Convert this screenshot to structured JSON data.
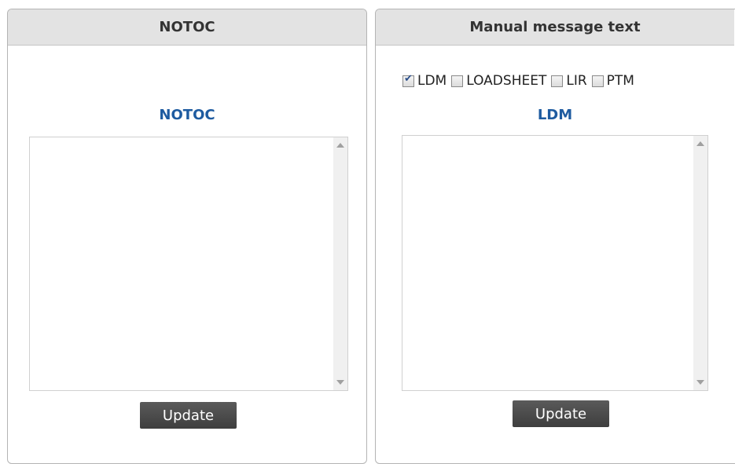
{
  "left_panel": {
    "header": "NOTOC",
    "section_title": "NOTOC",
    "textarea_value": "",
    "update_label": "Update"
  },
  "right_panel": {
    "header": "Manual message text",
    "checkboxes": [
      {
        "label": "LDM",
        "checked": true
      },
      {
        "label": "LOADSHEET",
        "checked": false
      },
      {
        "label": "LIR",
        "checked": false
      },
      {
        "label": "PTM",
        "checked": false
      }
    ],
    "section_title": "LDM",
    "textarea_value": "",
    "update_label": "Update"
  },
  "colors": {
    "title_blue": "#1e5ba0",
    "header_bg": "#e3e3e3",
    "button_bg": "#4a4a4a"
  }
}
